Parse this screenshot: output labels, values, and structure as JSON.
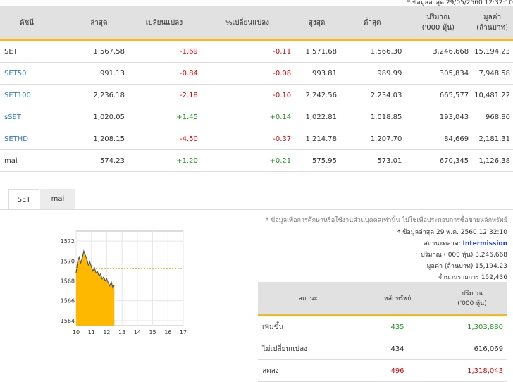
{
  "top_note": "* ข้อมูลล่าสุด 29/05/2560 12:32:10",
  "index_table": {
    "headers": [
      "ดัชนี",
      "ล่าสุด",
      "เปลี่ยนแปลง",
      "%เปลี่ยนแปลง",
      "สูงสุด",
      "ต่ำสุด",
      "ปริมาณ\n('000 หุ้น)",
      "มูลค่า\n(ล้านบาท)"
    ],
    "rows": [
      {
        "name": "SET",
        "last": "1,567.58",
        "change": "-1.69",
        "pct": "-0.11",
        "high": "1,571.68",
        "low": "1,566.30",
        "volume": "3,246,668",
        "value": "15,194.23",
        "dir": "neg",
        "link": false
      },
      {
        "name": "SET50",
        "last": "991.13",
        "change": "-0.84",
        "pct": "-0.08",
        "high": "993.81",
        "low": "989.99",
        "volume": "305,834",
        "value": "7,948.58",
        "dir": "neg",
        "link": true
      },
      {
        "name": "SET100",
        "last": "2,236.18",
        "change": "-2.18",
        "pct": "-0.10",
        "high": "2,242.56",
        "low": "2,234.03",
        "volume": "665,577",
        "value": "10,481.22",
        "dir": "neg",
        "link": true
      },
      {
        "name": "sSET",
        "last": "1,020.05",
        "change": "+1.45",
        "pct": "+0.14",
        "high": "1,022.81",
        "low": "1,018.85",
        "volume": "193,043",
        "value": "968.80",
        "dir": "pos",
        "link": true
      },
      {
        "name": "SETHD",
        "last": "1,208.15",
        "change": "-4.50",
        "pct": "-0.37",
        "high": "1,214.78",
        "low": "1,207.70",
        "volume": "84,669",
        "value": "2,181.31",
        "dir": "neg",
        "link": true
      },
      {
        "name": "mai",
        "last": "574.23",
        "change": "+1.20",
        "pct": "+0.21",
        "high": "575.95",
        "low": "573.01",
        "volume": "670,345",
        "value": "1,126.38",
        "dir": "pos",
        "link": false
      }
    ]
  },
  "tabs": [
    {
      "label": "SET",
      "active": true
    },
    {
      "label": "mai",
      "active": false
    }
  ],
  "chart_data": {
    "type": "area",
    "x_ticks": [
      "10",
      "11",
      "12",
      "13",
      "14",
      "15",
      "16",
      "17"
    ],
    "y_ticks": [
      "1564",
      "1566",
      "1568",
      "1570",
      "1572"
    ],
    "ylim": [
      1563.5,
      1573
    ],
    "xlim": [
      10,
      17
    ],
    "prev_close": 1569.27,
    "x": [
      10.0,
      10.1,
      10.2,
      10.3,
      10.4,
      10.5,
      10.6,
      10.7,
      10.8,
      10.9,
      11.0,
      11.1,
      11.2,
      11.3,
      11.4,
      11.5,
      11.6,
      11.7,
      11.8,
      11.9,
      12.0,
      12.1,
      12.2,
      12.3,
      12.4,
      12.5
    ],
    "y": [
      1568.8,
      1570.0,
      1570.4,
      1569.8,
      1570.3,
      1571.0,
      1570.6,
      1570.2,
      1569.6,
      1569.9,
      1569.4,
      1569.0,
      1569.3,
      1568.8,
      1568.9,
      1568.5,
      1568.7,
      1568.2,
      1568.4,
      1568.0,
      1568.2,
      1567.8,
      1567.5,
      1567.9,
      1567.3,
      1567.6
    ],
    "colors": {
      "area": "#ffb800",
      "line": "#555555",
      "prev": "#e8c000"
    }
  },
  "market_info": {
    "disclaimer": "* ข้อมูลเพื่อการศึกษาหรือใช้งานส่วนบุคคลเท่านั้น ไม่ใช่เพื่อประกอบการซื้อขายหลักทรัพย์",
    "latest": "* ข้อมูลล่าสุด 29 พ.ค. 2560 12:32:10",
    "status_label": "สถานะตลาด:",
    "status_value": "Intermission",
    "volume": "ปริมาณ ('000 หุ้น) 3,246,668",
    "value": "มูลค่า (ล้านบาท) 15,194.23",
    "trades": "จำนวนรายการ 152,436"
  },
  "stat_table": {
    "headers": [
      "สถานะ",
      "หลักทรัพย์",
      "ปริมาณ\n('000 หุ้น)"
    ],
    "rows": [
      {
        "status": "เพิ่มขึ้น",
        "count": "435",
        "volume": "1,303,880",
        "dir": "pos"
      },
      {
        "status": "ไม่เปลี่ยนแปลง",
        "count": "434",
        "volume": "616,069",
        "dir": ""
      },
      {
        "status": "ลดลง",
        "count": "496",
        "volume": "1,318,043",
        "dir": "neg"
      }
    ]
  }
}
